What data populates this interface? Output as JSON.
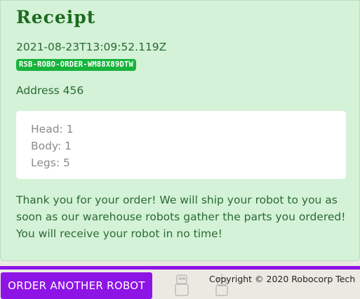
{
  "receipt": {
    "title": "Receipt",
    "timestamp": "2021-08-23T13:09:52.119Z",
    "order_id": "RSB-ROBO-ORDER-WM88X89DTW",
    "address": "Address 456",
    "parts": [
      {
        "label": "Head: 1"
      },
      {
        "label": "Body: 1"
      },
      {
        "label": "Legs: 5"
      }
    ],
    "message": "Thank you for your order! We will ship your robot to you as soon as our warehouse robots gather the parts you ordered! You will receive your robot in no time!"
  },
  "footer": {
    "order_another_label": "ORDER ANOTHER ROBOT",
    "copyright": "Copyright © 2020 Robocorp Tech"
  },
  "colors": {
    "receipt_background": "#d4f2d8",
    "badge": "#18b33b",
    "accent": "#8e14e6",
    "text_green": "#2a6a32"
  }
}
